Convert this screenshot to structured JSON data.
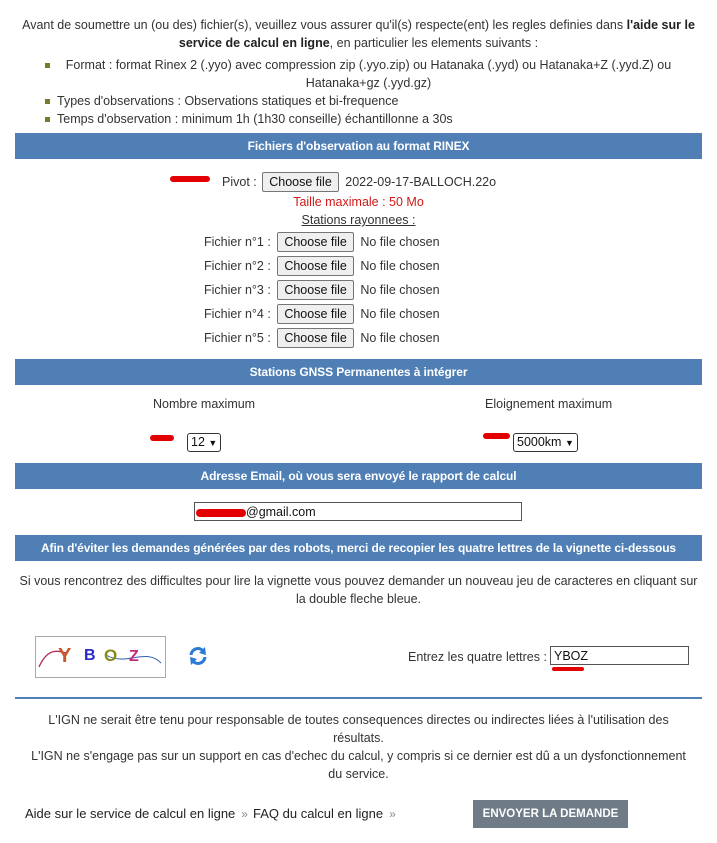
{
  "intro": {
    "text_before": "Avant de soumettre un (ou des) fichier(s), veuillez vous assurer qu'il(s) respecte(ent) les regles definies dans ",
    "bold": "l'aide sur le service de calcul en ligne",
    "text_after": ", en particulier les elements suivants :",
    "requirements": [
      "Format : format Rinex 2 (.yyo) avec compression zip (.yyo.zip) ou Hatanaka (.yyd) ou Hatanaka+Z (.yyd.Z) ou Hatanaka+gz (.yyd.gz)",
      "Types d'observations : Observations statiques et bi-frequence",
      "Temps d'observation : minimum 1h (1h30 conseille) échantillonne a 30s"
    ]
  },
  "rinex": {
    "header": "Fichiers d'observation au format RINEX",
    "pivot_label": "Pivot :",
    "choose_label": "Choose file",
    "pivot_file": "2022-09-17-BALLOCH.22o",
    "max_size": "Taille maximale : 50 Mo",
    "stations_title": "Stations rayonnees :",
    "no_file": "No file chosen",
    "files": [
      "Fichier n°1 :",
      "Fichier n°2 :",
      "Fichier n°3 :",
      "Fichier n°4 :",
      "Fichier n°5 :"
    ]
  },
  "gnss": {
    "header": "Stations GNSS Permanentes à intégrer",
    "nombre_label": "Nombre maximum",
    "nombre_value": "12",
    "eloignement_label": "Eloignement maximum",
    "eloignement_value": "5000km"
  },
  "email": {
    "header": "Adresse Email, où vous sera envoyé le rapport de calcul",
    "value": "@gmail.com"
  },
  "captcha": {
    "header": "Afin d'éviter les demandes générées par des robots, merci de recopier les quatre lettres de la vignette ci-dessous",
    "help": "Si vous rencontrez des difficultes pour lire la vignette vous pouvez demander un nouveau jeu de caracteres en cliquant sur la double fleche bleue.",
    "letters": [
      "Y",
      "B",
      "O",
      "Z"
    ],
    "letter_colors": [
      "#c85a2a",
      "#2a2ac8",
      "#8a8a1a",
      "#c82a7a"
    ],
    "enter_label": "Entrez les quatre lettres :",
    "enter_value": "YBOZ"
  },
  "footer": {
    "disclaimer1": "L'IGN ne serait être tenu pour responsable de toutes consequences directes ou indirectes liées à l'utilisation des résultats.",
    "disclaimer2": "L'IGN ne s'engage pas sur un support en cas d'echec du calcul, y compris si ce dernier est dû a un dysfonctionnement du service.",
    "link_aide": "Aide sur le service de calcul en ligne",
    "link_faq": "FAQ du calcul en ligne",
    "raquo": "»",
    "submit": "ENVOYER LA DEMANDE"
  }
}
